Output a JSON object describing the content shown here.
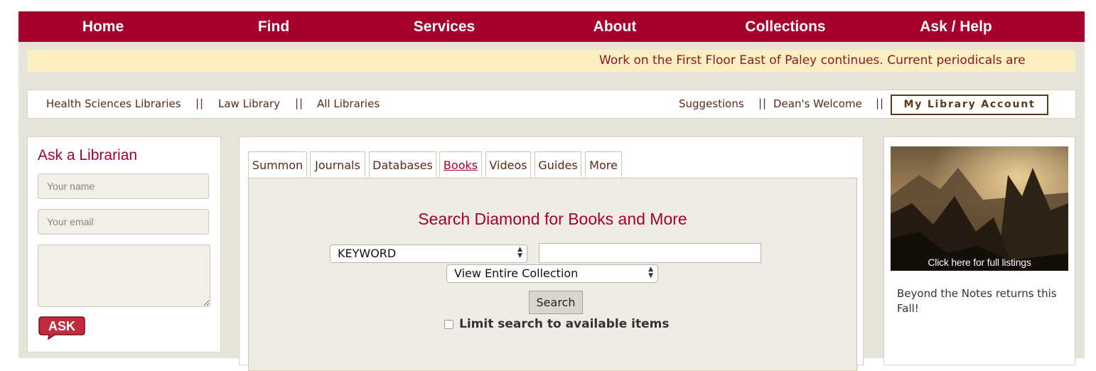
{
  "nav": {
    "items": [
      {
        "label": "Home"
      },
      {
        "label": "Find"
      },
      {
        "label": "Services"
      },
      {
        "label": "About"
      },
      {
        "label": "Collections"
      },
      {
        "label": "Ask / Help"
      }
    ]
  },
  "announcement": "Work on the First Floor East of Paley continues. Current periodicals are",
  "linkbar": {
    "left": [
      "Health Sciences Libraries",
      "Law Library",
      "All Libraries"
    ],
    "right": [
      "Suggestions",
      "Dean's Welcome"
    ],
    "separator": "||",
    "account_button": "My Library Account"
  },
  "ask_librarian": {
    "title": "Ask a Librarian",
    "name_placeholder": "Your name",
    "email_placeholder": "Your email",
    "ask_button": "ASK"
  },
  "search": {
    "tabs": [
      "Summon",
      "Journals",
      "Databases",
      "Books",
      "Videos",
      "Guides",
      "More"
    ],
    "active_tab": "Books",
    "heading": "Search Diamond for Books and More",
    "field_select": "KEYWORD",
    "collection_select": "View Entire Collection",
    "search_button": "Search",
    "limit_label": "Limit search to available items"
  },
  "promo": {
    "image_caption": "Click here for full listings",
    "text": "Beyond the Notes returns this Fall!"
  },
  "colors": {
    "brand": "#a6002c",
    "announce_bg": "#fbeec0",
    "page_bg": "#e6e3d9"
  }
}
